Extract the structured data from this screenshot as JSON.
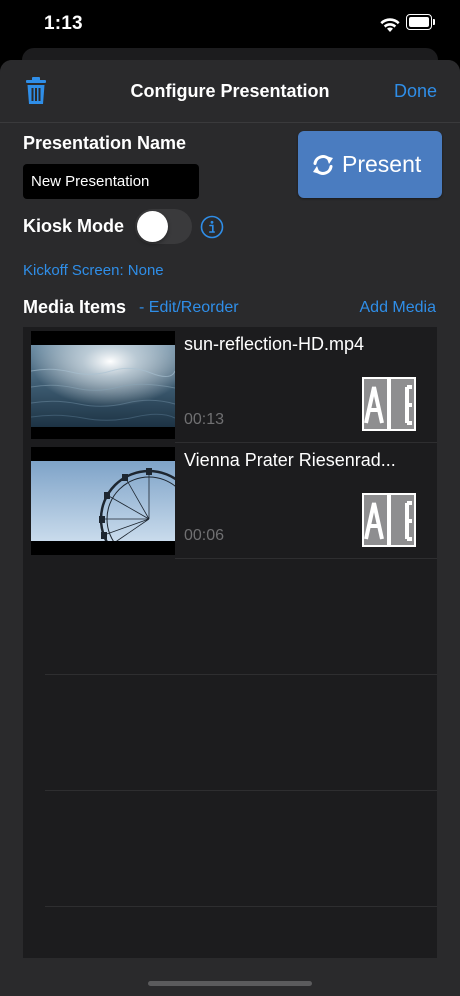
{
  "status_bar": {
    "time": "1:13",
    "icons": [
      "wifi-icon",
      "battery-icon"
    ]
  },
  "nav": {
    "title": "Configure Presentation",
    "done_label": "Done",
    "delete_icon": "trash-icon"
  },
  "presentation_name": {
    "label": "Presentation Name",
    "value": "New Presentation"
  },
  "present_button": {
    "label": "Present",
    "icon": "refresh-icon"
  },
  "kiosk": {
    "label": "Kiosk Mode",
    "enabled": false,
    "info_icon": "info-icon"
  },
  "kickoff": {
    "label": "Kickoff Screen: None"
  },
  "media_section": {
    "title": "Media Items",
    "edit_label": "- Edit/Reorder",
    "add_label": "Add Media"
  },
  "media_items": [
    {
      "title": "sun-reflection-HD.mp4",
      "duration": "00:13",
      "thumbnail": "water-reflection",
      "badge_icon": "ab-icon"
    },
    {
      "title": "Vienna Prater Riesenrad...",
      "duration": "00:06",
      "thumbnail": "ferris-wheel",
      "badge_icon": "ab-icon"
    }
  ],
  "colors": {
    "accent": "#2f8ee8",
    "present_button": "#4a7cc0",
    "sheet_background": "#2a2a2c",
    "list_background": "#1c1c1e"
  }
}
